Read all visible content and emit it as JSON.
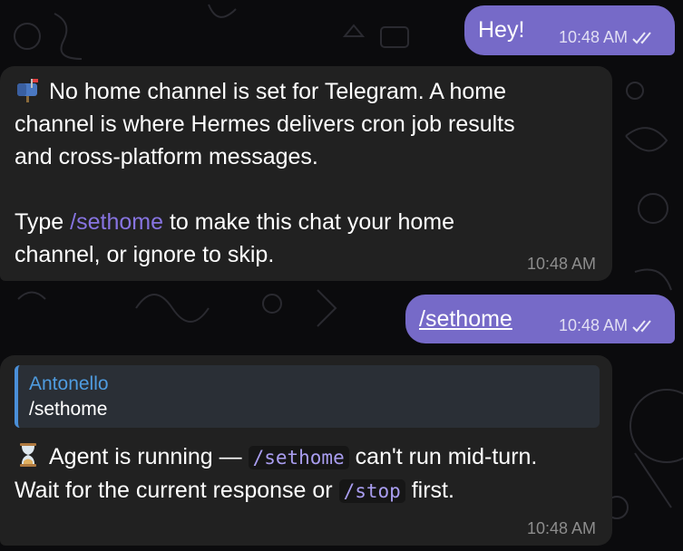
{
  "messages": {
    "m1": {
      "text": "Hey!",
      "time": "10:48 AM"
    },
    "m2": {
      "line1": "No home channel is set for Telegram. A home",
      "line2": "channel is where Hermes delivers cron job results",
      "line3": "and cross-platform messages.",
      "line4_pre": "Type ",
      "line4_cmd": "/sethome",
      "line4_post": " to make this chat your home",
      "line5": "channel, or ignore to skip.",
      "time": "10:48 AM",
      "emoji": "mailbox-icon"
    },
    "m3": {
      "text": "/sethome",
      "time": "10:48 AM"
    },
    "m4": {
      "reply_name": "Antonello",
      "reply_text": "/sethome",
      "line1_pre": "Agent is running — ",
      "line1_code": "/sethome",
      "line1_post": " can't run mid-turn.",
      "line2_pre": "Wait for the current response or ",
      "line2_code": "/stop",
      "line2_post": " first.",
      "time": "10:48 AM",
      "emoji": "hourglass-icon"
    }
  },
  "colors": {
    "outgoing_bubble": "#766ac8",
    "incoming_bubble": "#212121",
    "link": "#8774e1",
    "reply_accent": "#4a8fd8"
  }
}
